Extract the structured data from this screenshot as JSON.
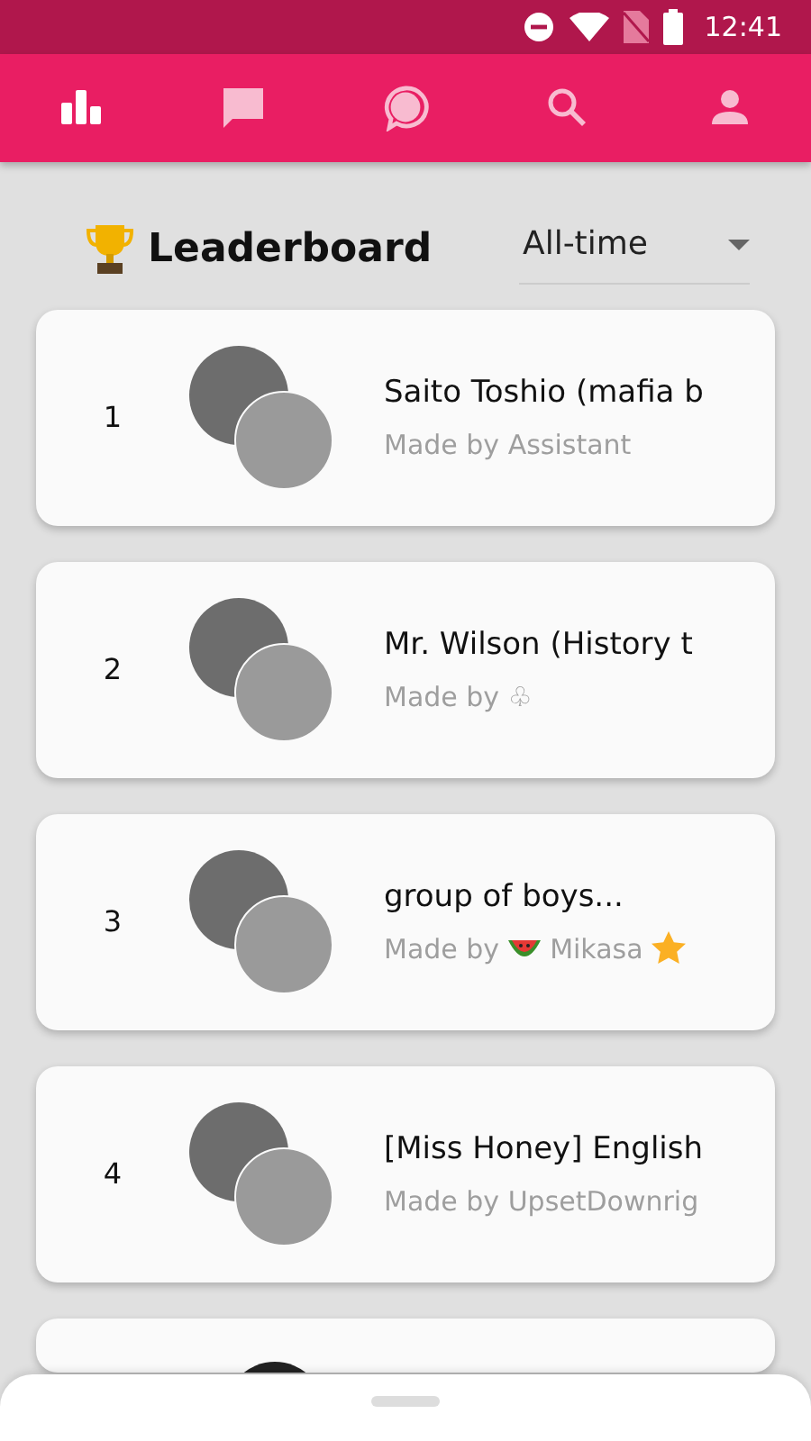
{
  "status_bar": {
    "time": "12:41"
  },
  "tabs": [
    {
      "kind": "chart",
      "selected": true
    },
    {
      "kind": "message",
      "selected": false
    },
    {
      "kind": "bubble",
      "selected": false
    },
    {
      "kind": "search",
      "selected": false
    },
    {
      "kind": "person",
      "selected": false
    }
  ],
  "header": {
    "title": "Leaderboard",
    "period": "All-time"
  },
  "entries": [
    {
      "rank": "1",
      "name": "Saito Toshio (mafia b",
      "creator": [
        {
          "kind": "text",
          "text": "Made by Assistant"
        }
      ]
    },
    {
      "rank": "2",
      "name": "Mr. Wilson (History t",
      "creator": [
        {
          "kind": "text",
          "text": "Made by ♧"
        }
      ]
    },
    {
      "rank": "3",
      "name": "group of boys...",
      "creator": [
        {
          "kind": "text",
          "text": "Made by"
        },
        {
          "kind": "watermelon"
        },
        {
          "kind": "text",
          "text": "Mikasa"
        },
        {
          "kind": "star"
        }
      ]
    },
    {
      "rank": "4",
      "name": "[Miss Honey] English",
      "creator": [
        {
          "kind": "text",
          "text": "Made by UpsetDownrig"
        }
      ]
    }
  ]
}
